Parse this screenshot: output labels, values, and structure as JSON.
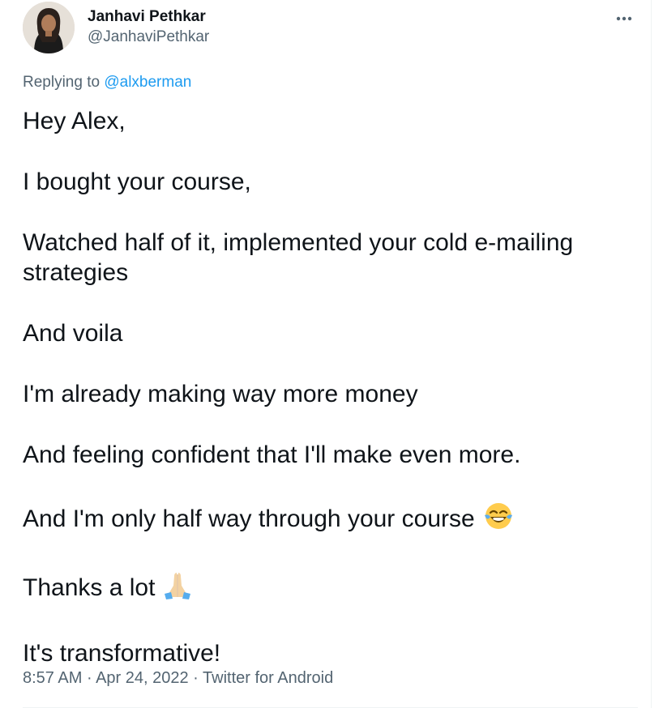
{
  "author": {
    "display_name": "Janhavi Pethkar",
    "handle": "@JanhaviPethkar"
  },
  "reply": {
    "prefix": "Replying to ",
    "mention": "@alxberman"
  },
  "tweet": {
    "p1": "Hey Alex,",
    "p2": "I bought your course,",
    "p3a": "Watched half of it, implemented your cold e-mailing",
    "p3b": "strategies",
    "p4": "And voila",
    "p5": "I'm already making way more money",
    "p6": "And feeling confident that I'll make even more.",
    "p7": "And I'm only half way through your course",
    "p8": "Thanks a lot",
    "p9": "It's transformative!"
  },
  "meta": {
    "time": "8:57 AM",
    "sep1": " · ",
    "date": "Apr 24, 2022",
    "sep2": " · ",
    "source": "Twitter for Android"
  },
  "icons": {
    "more": "more-horizontal-icon",
    "emoji_laugh": "face-with-tears-of-joy",
    "emoji_pray": "folded-hands"
  },
  "colors": {
    "text": "#0f1419",
    "secondary": "#536471",
    "link": "#1d9bf0"
  }
}
